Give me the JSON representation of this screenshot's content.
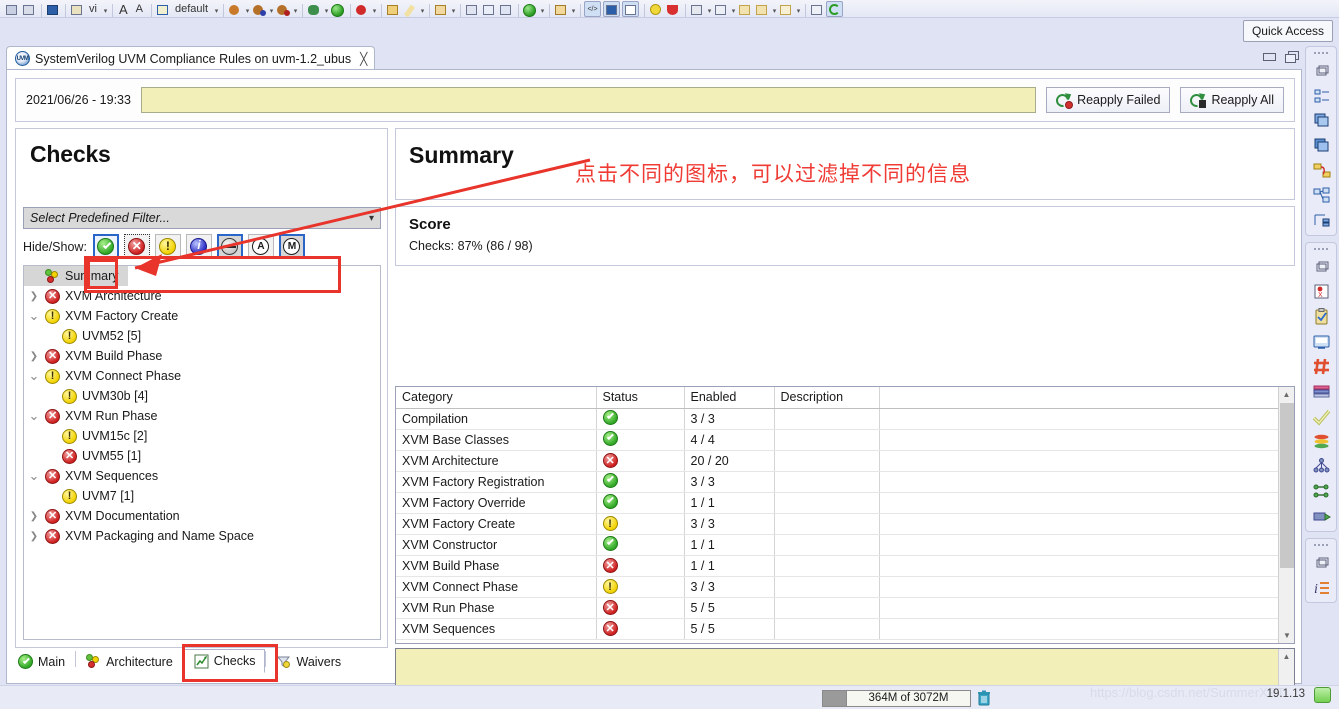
{
  "toolbar": {
    "quick_access": "Quick Access",
    "default_label": "default",
    "font_small": "A",
    "font_large": "A",
    "items": [
      {
        "name": "save-icon"
      },
      {
        "name": "save-all-icon"
      },
      {
        "name": "console-icon"
      },
      {
        "name": "columns-icon"
      },
      {
        "name": "vi-label",
        "label": "vi"
      },
      {
        "name": "font-decrease-icon"
      },
      {
        "name": "font-increase-icon"
      },
      {
        "name": "preset-icon"
      },
      {
        "name": "debug-icon"
      },
      {
        "name": "debug-blue-icon"
      },
      {
        "name": "debug-red-icon"
      },
      {
        "name": "bug-icon"
      },
      {
        "name": "run-icon"
      },
      {
        "name": "stop-icon"
      },
      {
        "name": "open-folder-icon"
      },
      {
        "name": "pencil-icon"
      },
      {
        "name": "new-wizard-icon"
      },
      {
        "name": "copy-icon"
      },
      {
        "name": "paste-icon"
      },
      {
        "name": "compare-icon"
      },
      {
        "name": "validate-icon"
      },
      {
        "name": "layout-icon"
      },
      {
        "name": "code-icon"
      },
      {
        "name": "panel-icon"
      },
      {
        "name": "wave-icon"
      },
      {
        "name": "lightbulb-icon"
      },
      {
        "name": "shield-icon"
      },
      {
        "name": "checklist-icon"
      },
      {
        "name": "filter-icon"
      },
      {
        "name": "tag-icon"
      },
      {
        "name": "tag2-icon"
      },
      {
        "name": "tag3-icon"
      },
      {
        "name": "grid-icon"
      },
      {
        "name": "refresh-icon"
      }
    ]
  },
  "editor": {
    "tab_title": "SystemVerilog UVM Compliance Rules on uvm-1.2_ubus",
    "tab_close": "╳",
    "minimize_title": "Minimize",
    "maximize_title": "Maximize"
  },
  "runbar": {
    "timestamp": "2021/06/26 - 19:33",
    "field_value": "",
    "reapply_failed": "Reapply Failed",
    "reapply_all": "Reapply All"
  },
  "checks": {
    "heading": "Checks",
    "filter_placeholder": "Select Predefined Filter...",
    "hide_show_label": "Hide/Show:",
    "filter_buttons": [
      {
        "name": "filter-pass-button",
        "icon": "green-check-icon",
        "selected": true,
        "dotted": false,
        "gray": false
      },
      {
        "name": "filter-fail-button",
        "icon": "red-x-icon",
        "selected": false,
        "dotted": true,
        "gray": false
      },
      {
        "name": "filter-warning-button",
        "icon": "yellow-warning-icon",
        "selected": false,
        "dotted": false,
        "gray": false
      },
      {
        "name": "filter-info-button",
        "icon": "blue-info-icon",
        "selected": false,
        "dotted": false,
        "gray": false
      },
      {
        "name": "filter-disabled-button",
        "icon": "gray-minus-icon",
        "selected": true,
        "dotted": false,
        "gray": true
      },
      {
        "name": "filter-auto-button",
        "icon": "letter-a-icon",
        "selected": false,
        "dotted": false,
        "gray": false
      },
      {
        "name": "filter-manual-button",
        "icon": "letter-m-icon",
        "selected": true,
        "dotted": false,
        "gray": true
      }
    ],
    "tree": [
      {
        "label": "Summary",
        "icon": "summary-icon",
        "twisty": "none",
        "indent": 1,
        "selected": true
      },
      {
        "label": "XVM Architecture",
        "icon": "red-x-icon",
        "twisty": "collapsed",
        "indent": 0,
        "selected": false
      },
      {
        "label": "XVM Factory Create",
        "icon": "yellow-warning-icon",
        "twisty": "expanded",
        "indent": 0,
        "selected": false
      },
      {
        "label": "UVM52 [5]",
        "icon": "yellow-warning-icon",
        "twisty": "none",
        "indent": 2,
        "selected": false
      },
      {
        "label": "XVM Build Phase",
        "icon": "red-x-icon",
        "twisty": "collapsed",
        "indent": 0,
        "selected": false
      },
      {
        "label": "XVM Connect Phase",
        "icon": "yellow-warning-icon",
        "twisty": "expanded",
        "indent": 0,
        "selected": false
      },
      {
        "label": "UVM30b [4]",
        "icon": "yellow-warning-icon",
        "twisty": "none",
        "indent": 2,
        "selected": false
      },
      {
        "label": "XVM Run Phase",
        "icon": "red-x-icon",
        "twisty": "expanded",
        "indent": 0,
        "selected": false
      },
      {
        "label": "UVM15c [2]",
        "icon": "yellow-warning-icon",
        "twisty": "none",
        "indent": 2,
        "selected": false
      },
      {
        "label": "UVM55 [1]",
        "icon": "red-x-icon",
        "twisty": "none",
        "indent": 2,
        "selected": false
      },
      {
        "label": "XVM Sequences",
        "icon": "red-x-icon",
        "twisty": "expanded",
        "indent": 0,
        "selected": false
      },
      {
        "label": "UVM7 [1]",
        "icon": "yellow-warning-icon",
        "twisty": "none",
        "indent": 2,
        "selected": false
      },
      {
        "label": "XVM Documentation",
        "icon": "red-x-icon",
        "twisty": "collapsed",
        "indent": 0,
        "selected": false
      },
      {
        "label": "XVM Packaging and Name Space",
        "icon": "red-x-icon",
        "twisty": "collapsed",
        "indent": 0,
        "selected": false
      }
    ]
  },
  "annotation": {
    "text": "点击不同的图标，可以过滤掉不同的信息",
    "color": "#ef3b34"
  },
  "summary": {
    "title": "Summary",
    "score_title": "Score",
    "score_line": "Checks: 87% (86 / 98)",
    "columns": [
      "Category",
      "Status",
      "Enabled",
      "Description",
      ""
    ],
    "rows": [
      {
        "category": "Compilation",
        "status": "green-check-icon",
        "enabled": "3 / 3",
        "description": ""
      },
      {
        "category": "XVM Base Classes",
        "status": "green-check-icon",
        "enabled": "4 / 4",
        "description": ""
      },
      {
        "category": "XVM Architecture",
        "status": "red-x-icon",
        "enabled": "20 / 20",
        "description": ""
      },
      {
        "category": "XVM Factory Registration",
        "status": "green-check-icon",
        "enabled": "3 / 3",
        "description": ""
      },
      {
        "category": "XVM Factory Override",
        "status": "green-check-icon",
        "enabled": "1 / 1",
        "description": ""
      },
      {
        "category": "XVM Factory Create",
        "status": "yellow-warning-icon",
        "enabled": "3 / 3",
        "description": ""
      },
      {
        "category": "XVM Constructor",
        "status": "green-check-icon",
        "enabled": "1 / 1",
        "description": ""
      },
      {
        "category": "XVM Build Phase",
        "status": "red-x-icon",
        "enabled": "1 / 1",
        "description": ""
      },
      {
        "category": "XVM Connect Phase",
        "status": "yellow-warning-icon",
        "enabled": "3 / 3",
        "description": ""
      },
      {
        "category": "XVM Run Phase",
        "status": "red-x-icon",
        "enabled": "5 / 5",
        "description": ""
      },
      {
        "category": "XVM Sequences",
        "status": "red-x-icon",
        "enabled": "5 / 5",
        "description": ""
      }
    ],
    "description_text": ""
  },
  "bottom_tabs": [
    {
      "label": "Main",
      "icon": "green-check-icon",
      "active": false,
      "name": "tab-main"
    },
    {
      "label": "Architecture",
      "icon": "summary-icon",
      "active": false,
      "name": "tab-architecture"
    },
    {
      "label": "Checks",
      "icon": "chart-icon",
      "active": true,
      "name": "tab-checks"
    },
    {
      "label": "Waivers",
      "icon": "filter-icon",
      "active": false,
      "name": "tab-waivers"
    }
  ],
  "right_toolbar": {
    "groups": [
      [
        "restore-icon",
        "outline-icon",
        "stack-icon",
        "stack2-icon",
        "relation-icon",
        "hierarchy-icon",
        "tree-filter-icon"
      ],
      [
        "restore-icon",
        "register-icon",
        "clipboard-check-icon",
        "monitor-icon",
        "hash-icon",
        "table-icon",
        "checkmark-icon",
        "layers-icon",
        "network-icon",
        "connect-icon",
        "export-icon"
      ],
      [
        "restore-icon",
        "info-list-icon"
      ]
    ]
  },
  "statusbar": {
    "heap": "364M of 3072M",
    "trash_icon": "trash-icon",
    "watermark": "https://blog.csdn.net/SummerXRT",
    "version": "19.1.13",
    "status_indicator": "green-status-icon"
  }
}
